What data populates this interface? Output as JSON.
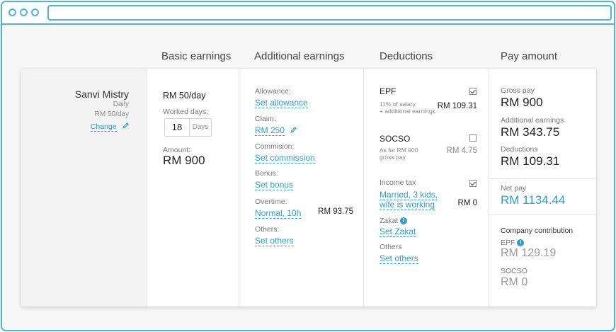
{
  "headers": {
    "basic": "Basic earnings",
    "additional": "Additional earnings",
    "deductions": "Deductions",
    "pay": "Pay amount"
  },
  "employee": {
    "name": "Sanvi Mistry",
    "type": "Daily",
    "rate": "RM 50/day",
    "change": "Change"
  },
  "basic": {
    "rate": "RM 50/day",
    "worked_label": "Worked days:",
    "worked_days": "18",
    "days_unit": "Days",
    "amount_label": "Amount:",
    "amount": "RM 900"
  },
  "additional": {
    "allowance_label": "Allowance:",
    "allowance_link": "Set allowance",
    "claim_label": "Claim:",
    "claim_link": "RM 250",
    "commission_label": "Commision:",
    "commission_link": "Set commission",
    "bonus_label": "Bonus:",
    "bonus_link": "Set bonus",
    "overtime_label": "Overtime:",
    "overtime_link": "Normal, 10h",
    "overtime_amount": "RM 93.75",
    "others_label": "Others:",
    "others_link": "Set others"
  },
  "deductions": {
    "epf_title": "EPF",
    "epf_note1": "11% of salary",
    "epf_note2": "+ additional earnings",
    "epf_amount": "RM 109.31",
    "epf_checked": true,
    "socso_title": "SOCSO",
    "socso_note1": "As for RM 900",
    "socso_note2": "gross pay",
    "socso_amount": "RM 4.75",
    "socso_checked": false,
    "tax_label": "Income tax",
    "tax_link1": "Married, 3 kids,",
    "tax_link2": "wife is working",
    "tax_amount": "RM 0",
    "tax_checked": true,
    "zakat_label": "Zakat",
    "zakat_link": "Set Zakat",
    "others_label": "Others",
    "others_link": "Set others"
  },
  "pay": {
    "gross_label": "Gross pay",
    "gross": "RM 900",
    "additional_label": "Additional earnings",
    "additional": "RM 343.75",
    "deductions_label": "Deductions",
    "deductions": "RM 109.31",
    "net_label": "Net pay",
    "net": "RM 1134.44",
    "company_label": "Company contribution",
    "c_epf_label": "EPF",
    "c_epf": "RM 129.19",
    "c_socso_label": "SOCSO",
    "c_socso": "RM 0"
  },
  "colors": {
    "accent": "#2e9ec7",
    "frame": "#4fb3d9"
  },
  "icons": {
    "edit": "pencil-icon",
    "info": "info-icon"
  }
}
